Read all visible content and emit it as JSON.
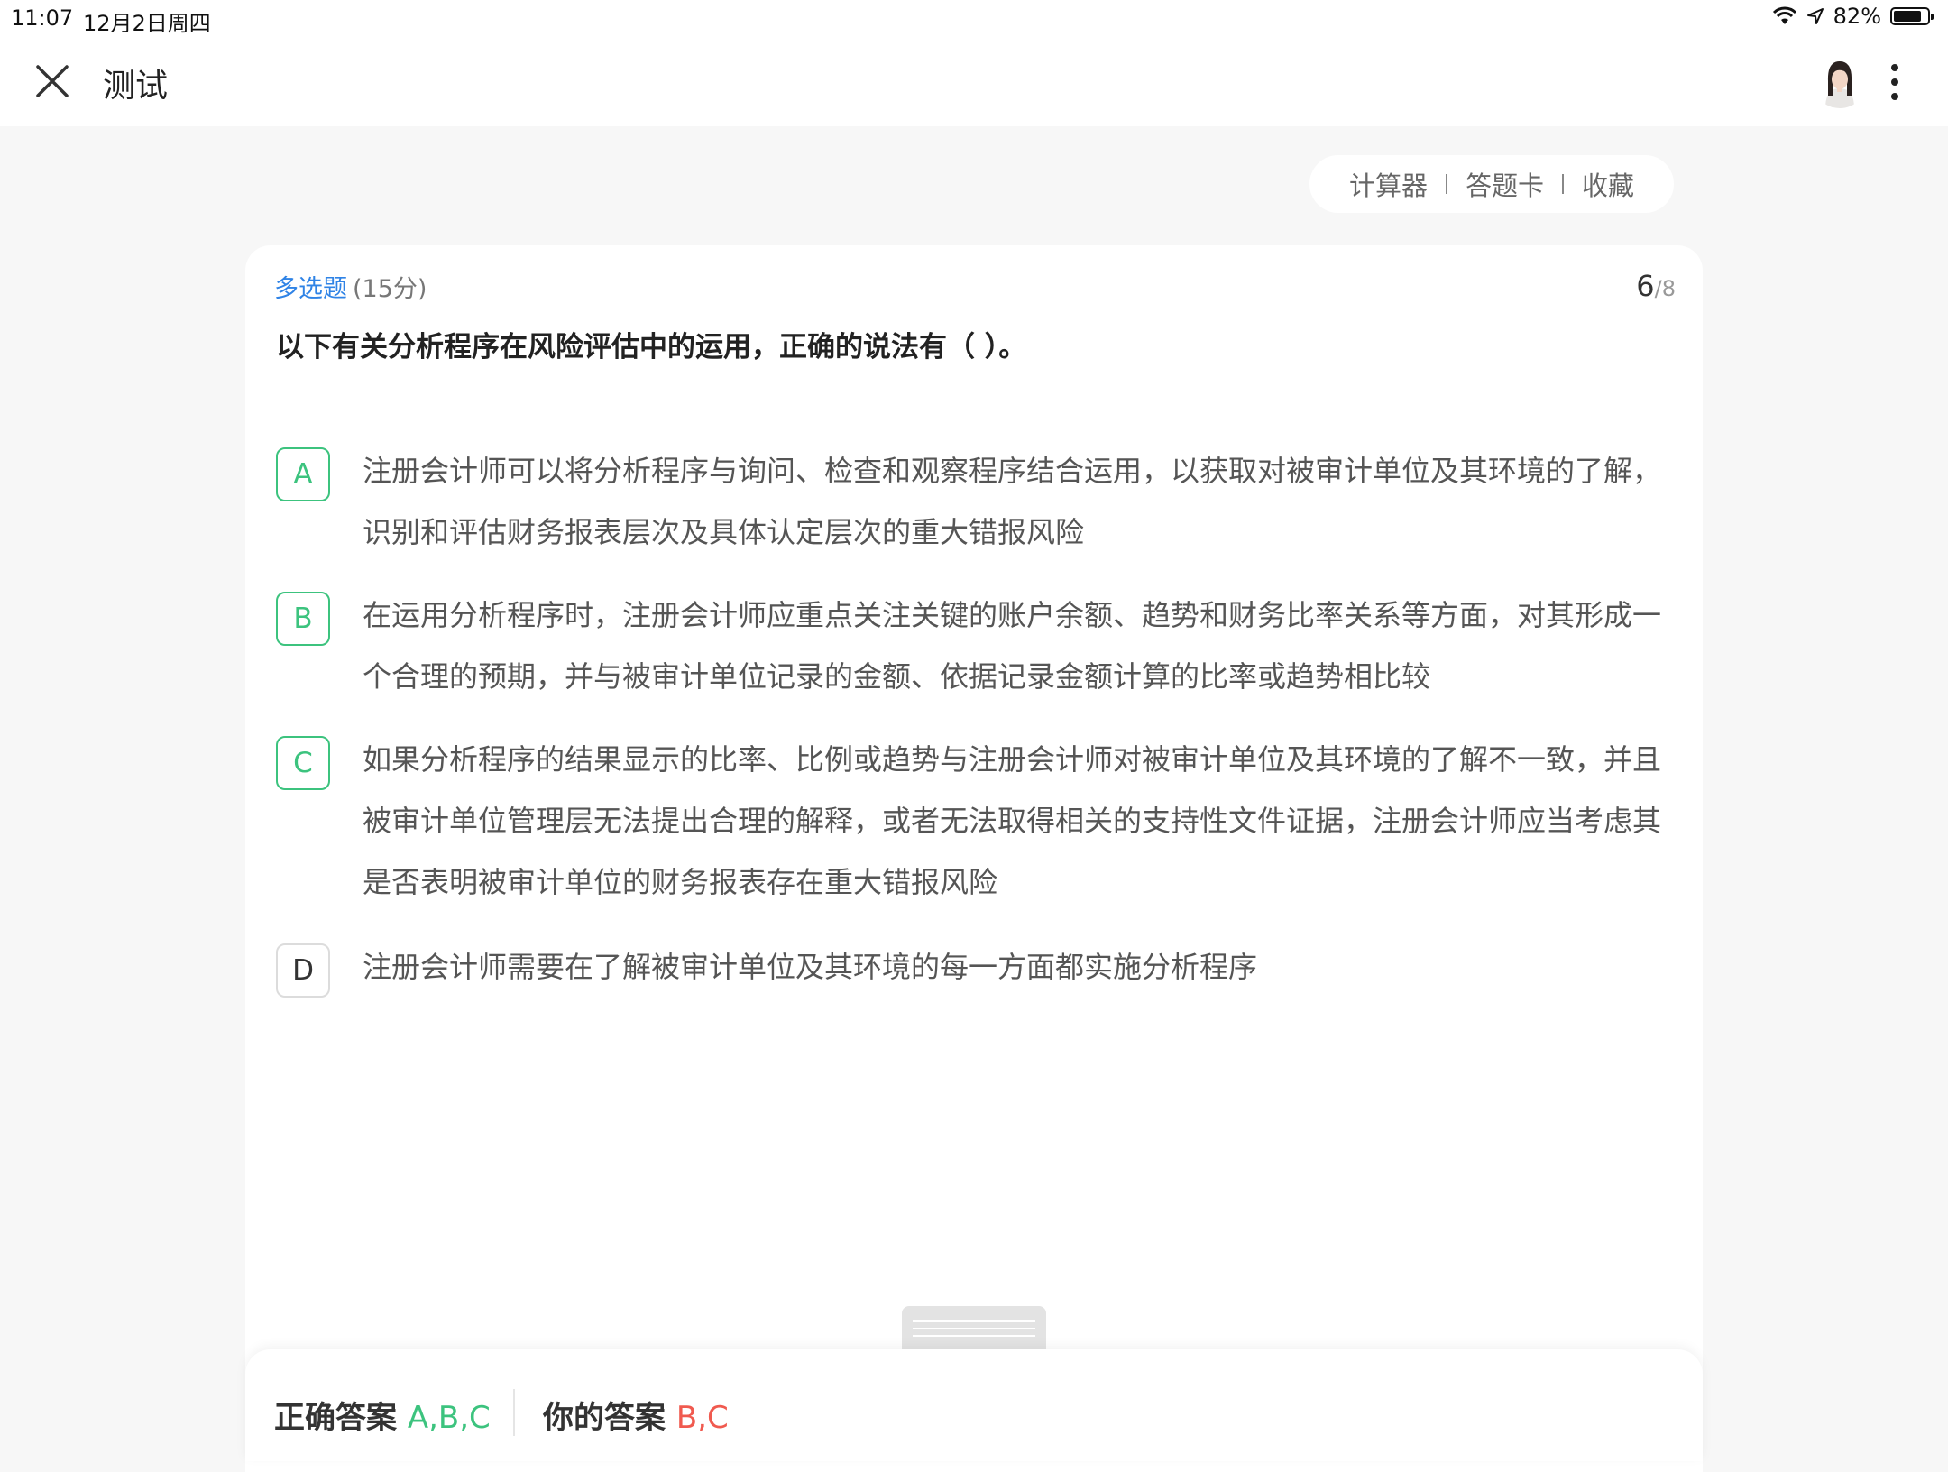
{
  "status_bar": {
    "time": "11:07",
    "date": "12月2日周四",
    "battery": "82%",
    "battery_level": 0.82
  },
  "header": {
    "title": "测试"
  },
  "tools": {
    "calculator": "计算器",
    "answer_card": "答题卡",
    "favorite": "收藏"
  },
  "question": {
    "type": "多选题",
    "score": "(15分)",
    "current": "6",
    "total": "/8",
    "text": "以下有关分析程序在风险评估中的运用，正确的说法有（    ）。",
    "options": [
      {
        "letter": "A",
        "text": "注册会计师可以将分析程序与询问、检查和观察程序结合运用，以获取对被审计单位及其环境的了解，识别和评估财务报表层次及具体认定层次的重大错报风险"
      },
      {
        "letter": "B",
        "text": "在运用分析程序时，注册会计师应重点关注关键的账户余额、趋势和财务比率关系等方面，对其形成一个合理的预期，并与被审计单位记录的金额、依据记录金额计算的比率或趋势相比较"
      },
      {
        "letter": "C",
        "text": "如果分析程序的结果显示的比率、比例或趋势与注册会计师对被审计单位及其环境的了解不一致，并且被审计单位管理层无法提出合理的解释，或者无法取得相关的支持性文件证据，注册会计师应当考虑其是否表明被审计单位的财务报表存在重大错报风险"
      },
      {
        "letter": "D",
        "text": "注册会计师需要在了解被审计单位及其环境的每一方面都实施分析程序"
      }
    ]
  },
  "answer": {
    "correct_label": "正确答案",
    "correct_value": "A,B,C",
    "mine_label": "你的答案",
    "mine_value": "B,C"
  },
  "colors": {
    "accent_blue": "#2f83e6",
    "correct_green": "#3cc37e",
    "wrong_red": "#f05a4f"
  }
}
